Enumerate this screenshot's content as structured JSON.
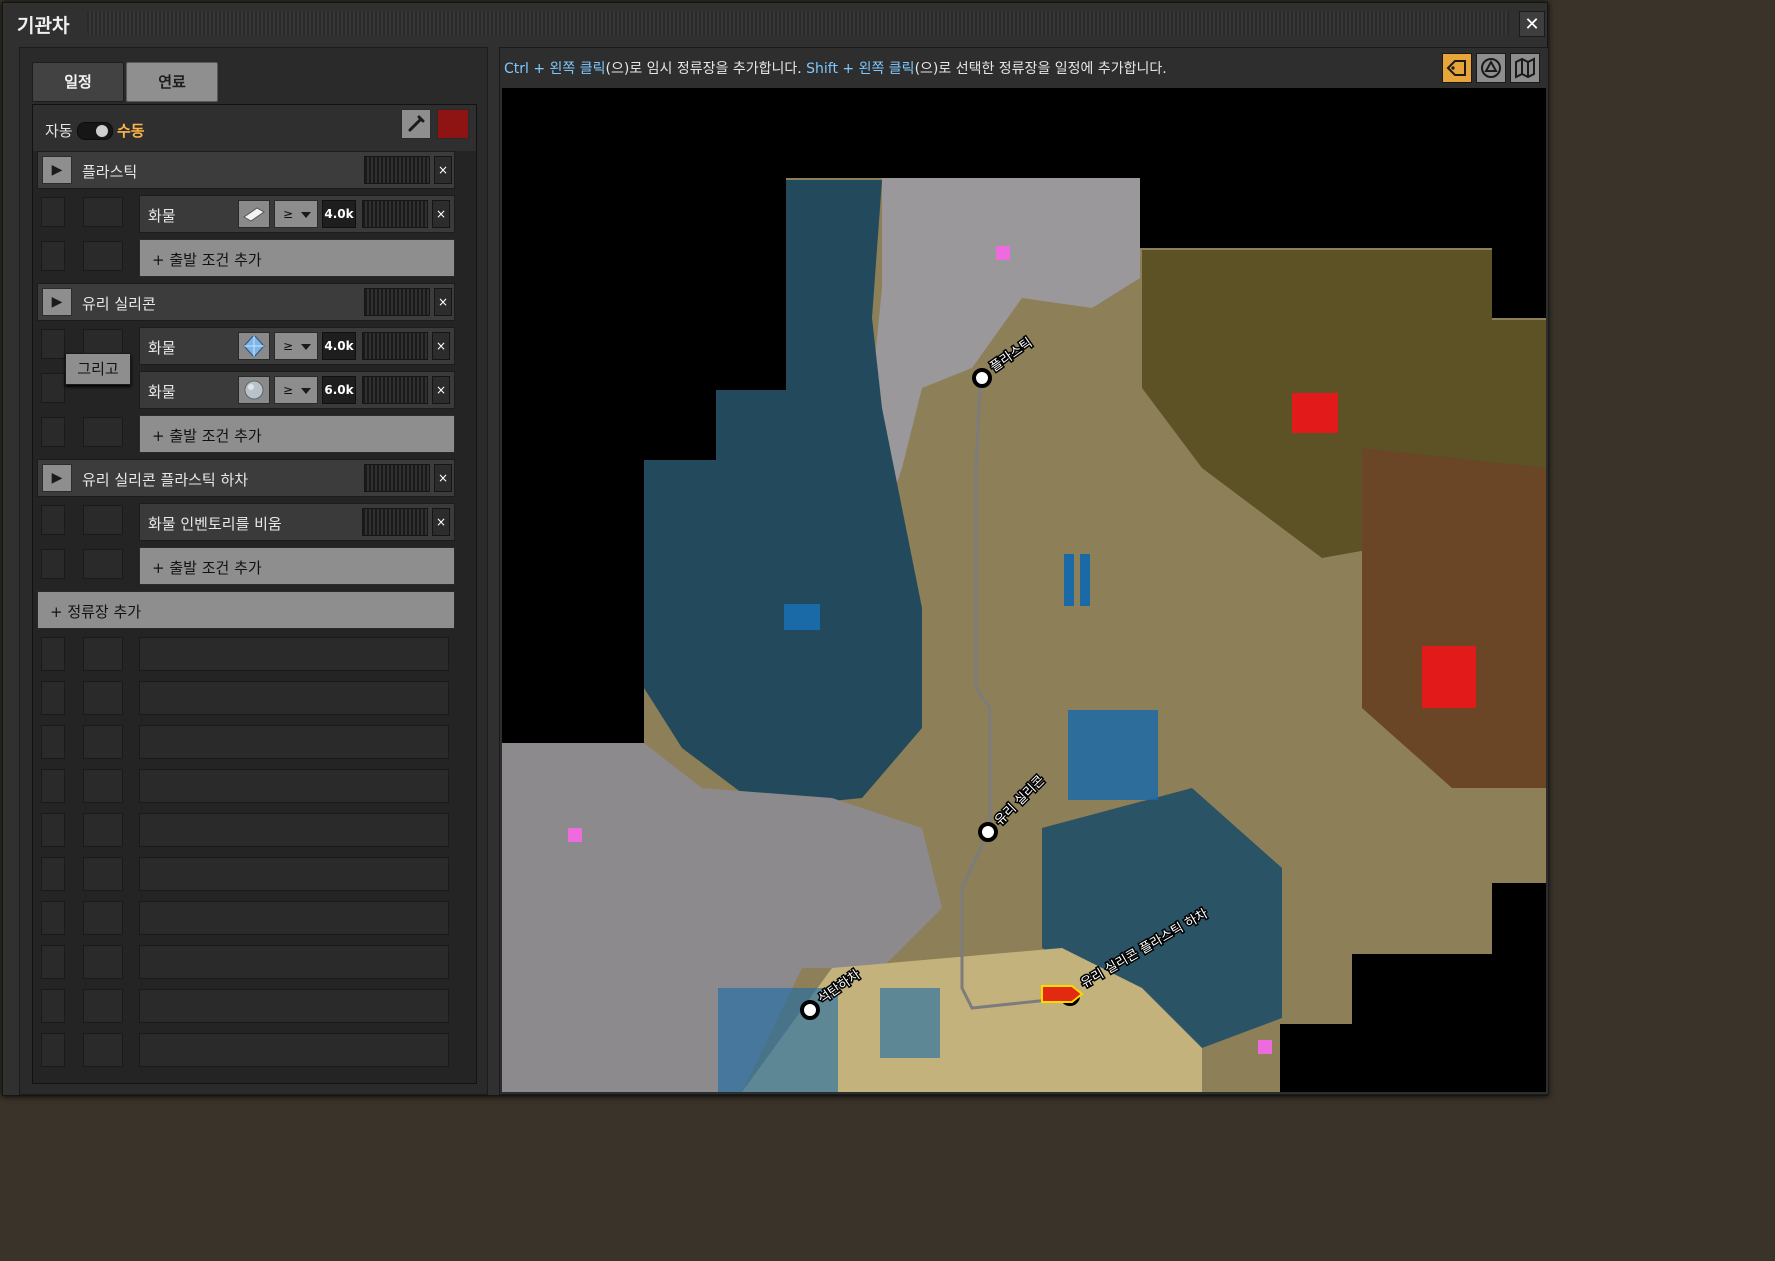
{
  "window": {
    "title": "기관차",
    "close_label": "✕"
  },
  "tabs": [
    {
      "label": "일정",
      "active": true
    },
    {
      "label": "연료",
      "active": false
    }
  ],
  "mode": {
    "auto_label": "자동",
    "manual_label": "수동",
    "selected": "수동",
    "color": "#8e1313"
  },
  "schedule": [
    {
      "station": "플라스틱",
      "conditions": [
        {
          "label": "화물",
          "item_icon": "plastic-bar-icon",
          "comparator": "≥",
          "value": "4.0k"
        }
      ],
      "add_condition_label": "+ 출발 조건 추가"
    },
    {
      "station": "유리 실리콘",
      "conditions": [
        {
          "label": "화물",
          "item_icon": "silicon-crystal-icon",
          "comparator": "≥",
          "value": "4.0k"
        },
        {
          "label": "화물",
          "item_icon": "ore-chunk-icon",
          "comparator": "≥",
          "value": "6.0k"
        }
      ],
      "and_label": "그리고",
      "add_condition_label": "+ 출발 조건 추가"
    },
    {
      "station": "유리 실리콘 플라스틱 하차",
      "conditions": [
        {
          "label": "화물 인벤토리를 비움"
        }
      ],
      "add_condition_label": "+ 출발 조건 추가"
    }
  ],
  "add_station_label": "+ 정류장 추가",
  "hint": {
    "p1_key": "Ctrl + 왼쪽 클릭",
    "p1_text": "(으)로 임시 정류장을 추가합니다.",
    "p2_key": "Shift + 왼쪽 클릭",
    "p2_text": "(으)로 선택한 정류장을 일정에 추가합니다."
  },
  "map_buttons": [
    {
      "name": "show-station-names-button",
      "icon": "abc-tag-icon",
      "active": true
    },
    {
      "name": "map-view-toggle-button",
      "icon": "radar-icon",
      "active": false
    },
    {
      "name": "open-map-button",
      "icon": "map-icon",
      "active": false
    }
  ],
  "map_labels": {
    "plastic": "플라스틱",
    "glass_silicon": "유리 실리콘",
    "coal_unload": "석탄하차",
    "unload": "유리 실리콘 플라스틱 하차"
  }
}
